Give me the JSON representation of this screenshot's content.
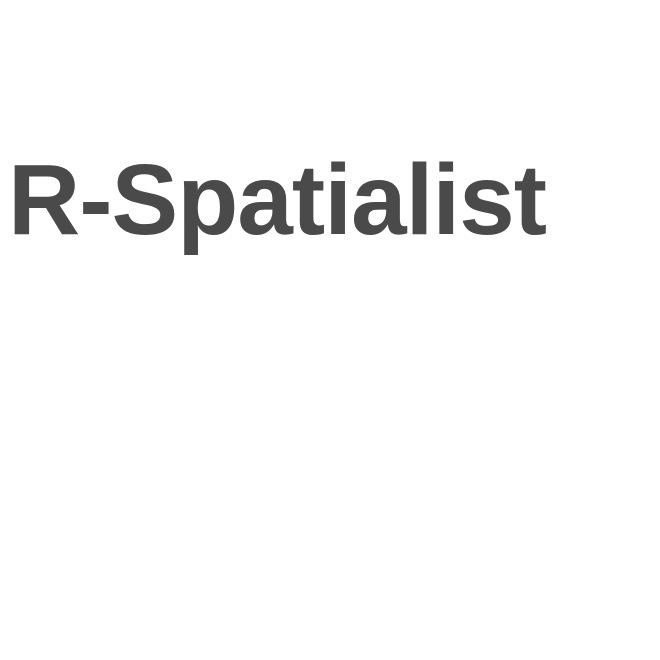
{
  "page": {
    "title": "R-Spatialist",
    "text_color": "#4a4a4a",
    "background_color": "#ffffff"
  }
}
